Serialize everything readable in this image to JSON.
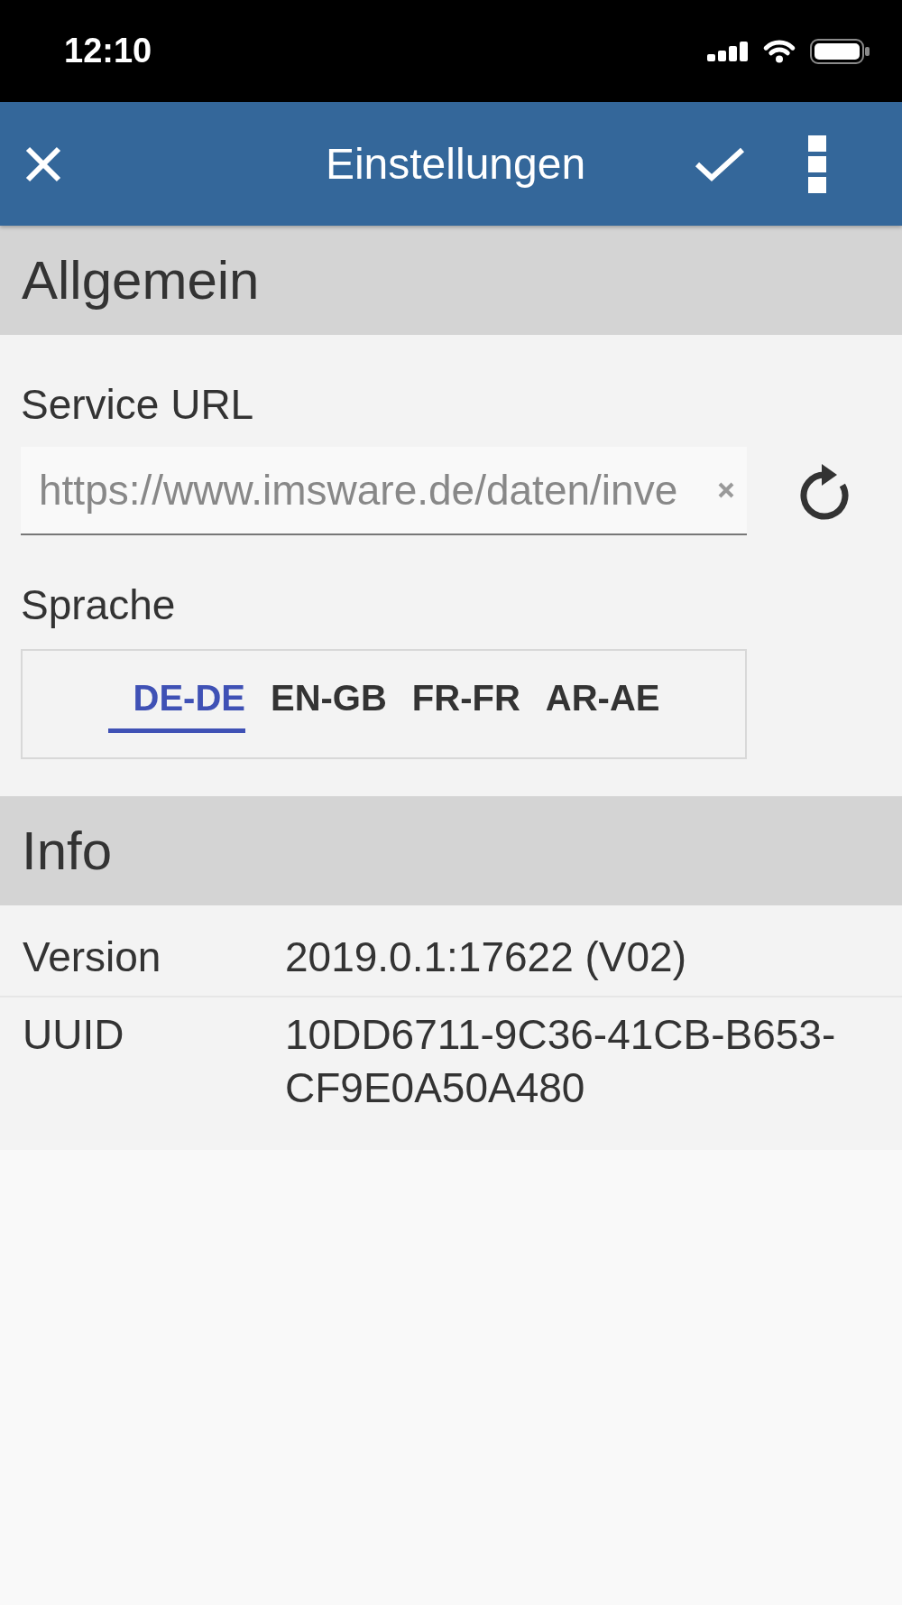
{
  "status_bar": {
    "time": "12:10"
  },
  "app_bar": {
    "title": "Einstellungen"
  },
  "general": {
    "title": "Allgemein",
    "service_url": {
      "label": "Service URL",
      "value": "https://www.imsware.de/daten/inve"
    },
    "language": {
      "label": "Sprache",
      "tabs": [
        {
          "label": "DE-DE",
          "selected": true
        },
        {
          "label": "EN-GB",
          "selected": false
        },
        {
          "label": "FR-FR",
          "selected": false
        },
        {
          "label": "AR-AE",
          "selected": false
        }
      ]
    }
  },
  "info": {
    "title": "Info",
    "rows": [
      {
        "label": "Version",
        "value": "2019.0.1:17622 (V02)"
      },
      {
        "label": "UUID",
        "value": "10DD6711-9C36-41CB-B653-CF9E0A50A480"
      }
    ]
  }
}
